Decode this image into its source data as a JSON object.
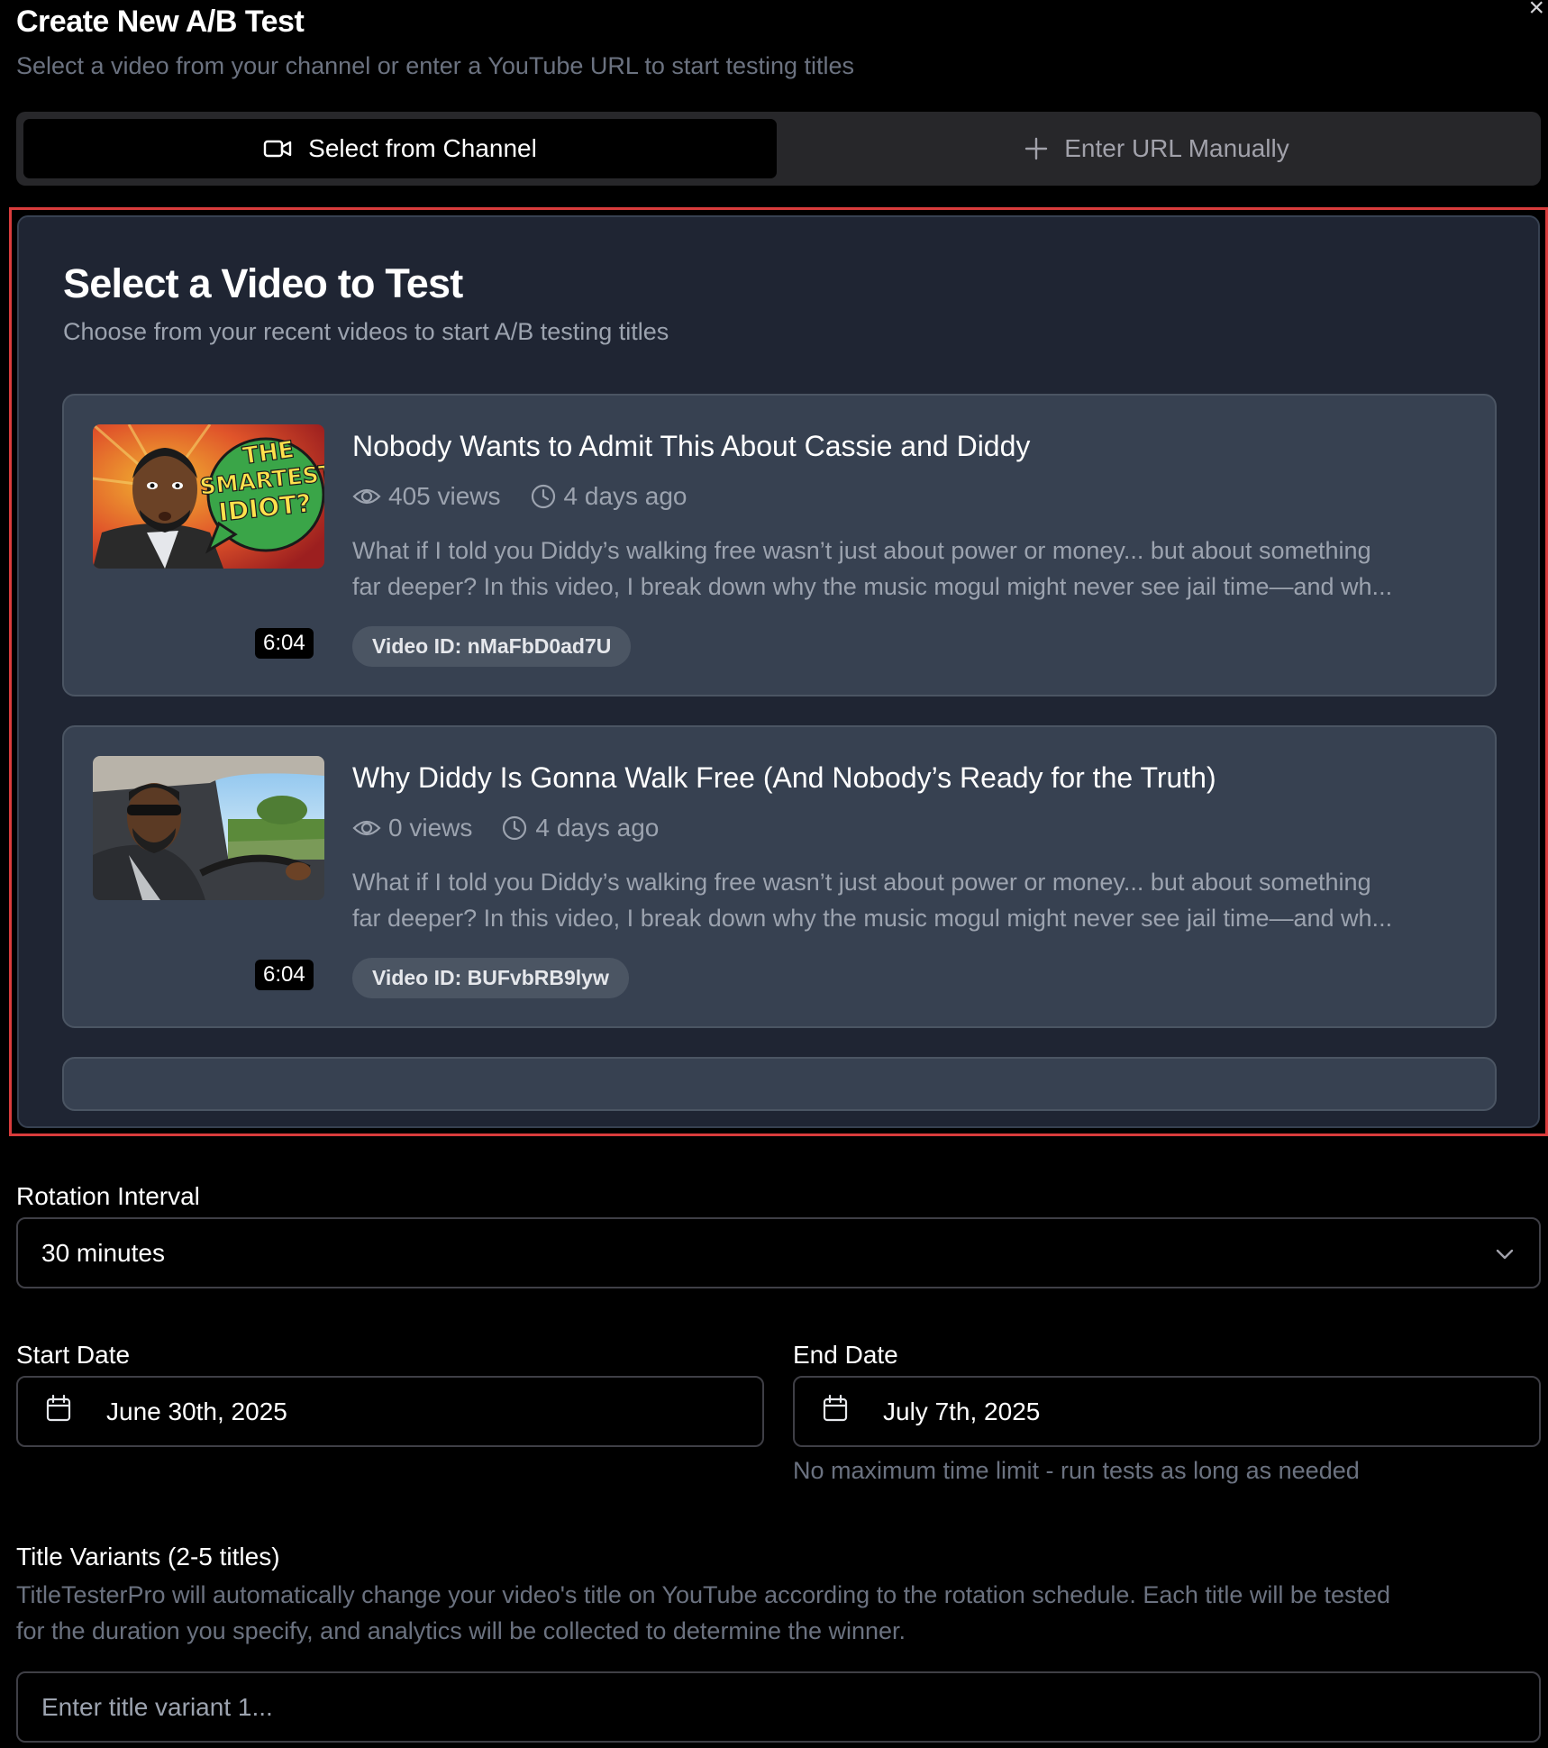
{
  "dialog": {
    "title": "Create New A/B Test",
    "subtitle": "Select a video from your channel or enter a YouTube URL to start testing titles",
    "close_symbol": "×"
  },
  "tabs": [
    {
      "label": "Select from Channel",
      "icon": "video-camera-icon",
      "active": true
    },
    {
      "label": "Enter URL Manually",
      "icon": "plus-icon",
      "active": false
    }
  ],
  "video_panel": {
    "title": "Select a Video to Test",
    "subtitle": "Choose from your recent videos to start A/B testing titles",
    "videos": [
      {
        "title": "Nobody Wants to Admit This About Cassie and Diddy",
        "views": "405 views",
        "age": "4 days ago",
        "description_line1": "What if I told you Diddy’s walking free wasn’t just about power or money... but about something",
        "description_line2": "far deeper? In this video, I break down why the music mogul might never see jail time—and wh...",
        "video_id": "Video ID: nMaFbD0ad7U",
        "duration": "6:04",
        "thumbnail_text": "THE SMARTEST IDIOT?"
      },
      {
        "title": "Why Diddy Is Gonna Walk Free (And Nobody’s Ready for the Truth)",
        "views": "0 views",
        "age": "4 days ago",
        "description_line1": "What if I told you Diddy’s walking free wasn’t just about power or money... but about something",
        "description_line2": "far deeper? In this video, I break down why the music mogul might never see jail time—and wh...",
        "video_id": "Video ID: BUFvbRB9lyw",
        "duration": "6:04"
      }
    ]
  },
  "rotation": {
    "label": "Rotation Interval",
    "value": "30 minutes"
  },
  "dates": {
    "start_label": "Start Date",
    "start_value": "June 30th, 2025",
    "end_label": "End Date",
    "end_value": "July 7th, 2025",
    "hint": "No maximum time limit - run tests as long as needed"
  },
  "variants": {
    "label": "Title Variants (2-5 titles)",
    "help_line1": "TitleTesterPro will automatically change your video's title on YouTube according to the rotation schedule. Each title will be tested",
    "help_line2": "for the duration you specify, and analytics will be collected to determine the winner.",
    "input_placeholder": "Enter title variant 1..."
  },
  "colors": {
    "background": "#000000",
    "panel": "#1f2533",
    "card": "#374151",
    "highlight_border": "#d93c3c",
    "muted_text": "#9ca3af"
  }
}
